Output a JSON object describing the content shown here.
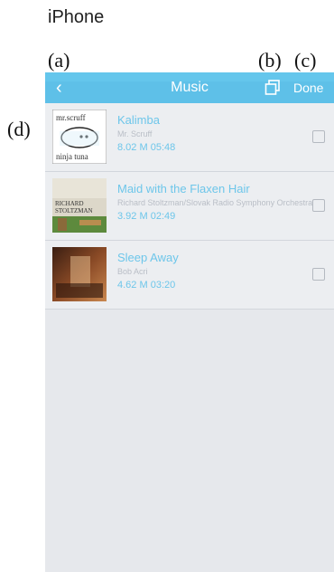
{
  "caption": "iPhone",
  "annotations": {
    "a": "(a)",
    "b": "(b)",
    "c": "(c)",
    "d": "(d)"
  },
  "navbar": {
    "back_label": "‹",
    "title": "Music",
    "done_label": "Done"
  },
  "tracks": [
    {
      "title": "Kalimba",
      "artist": "Mr. Scruff",
      "size": "8.02 M",
      "duration": "05:48",
      "art_text_top": "mr.scruff",
      "art_text_bottom": "ninja tuna"
    },
    {
      "title": "Maid with the Flaxen Hair",
      "artist": "Richard Stoltzman/Slovak Radio Symphony Orchestra",
      "size": "3.92 M",
      "duration": "02:49",
      "art_text_top": "RICHARD",
      "art_text_bottom": "STOLTZMAN"
    },
    {
      "title": "Sleep Away",
      "artist": "Bob Acri",
      "size": "4.62 M",
      "duration": "03:20"
    }
  ],
  "colors": {
    "navbar": "#5ec0e8",
    "accent_text": "#6dc6ea",
    "list_bg": "#e6e8ec"
  }
}
